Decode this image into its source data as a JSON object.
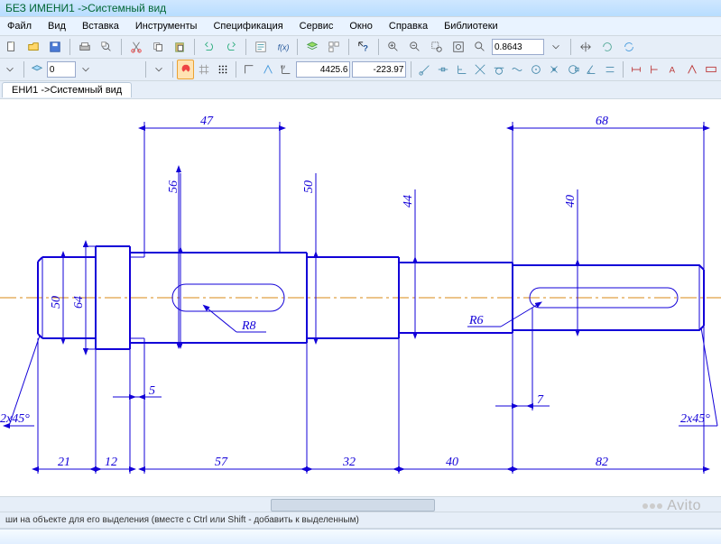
{
  "title": "БЕЗ ИМЕНИ1 ->Системный вид",
  "menu": [
    "Файл",
    "Вид",
    "Вставка",
    "Инструменты",
    "Спецификация",
    "Сервис",
    "Окно",
    "Справка",
    "Библиотеки"
  ],
  "toolbar2": {
    "zoom": "0.8643",
    "coord_x": "4425.6",
    "coord_y": "-223.97"
  },
  "tab_doc": "ЕНИ1  ->Системный вид",
  "dims": {
    "len47": "47",
    "len68": "68",
    "d56": "56",
    "d50t": "50",
    "d44": "44",
    "d40": "40",
    "d50l": "50",
    "d64": "64",
    "r8": "R8",
    "r6": "R6",
    "len5": "5",
    "len7": "7",
    "ch1": "2x45°",
    "ch2": "2x45°",
    "len21": "21",
    "len12": "12",
    "len57": "57",
    "len32": "32",
    "len40": "40",
    "len82": "82"
  },
  "status": "ши на объекте для его выделения (вместе с Ctrl или Shift - добавить к выделенным)",
  "watermark": "Avito"
}
